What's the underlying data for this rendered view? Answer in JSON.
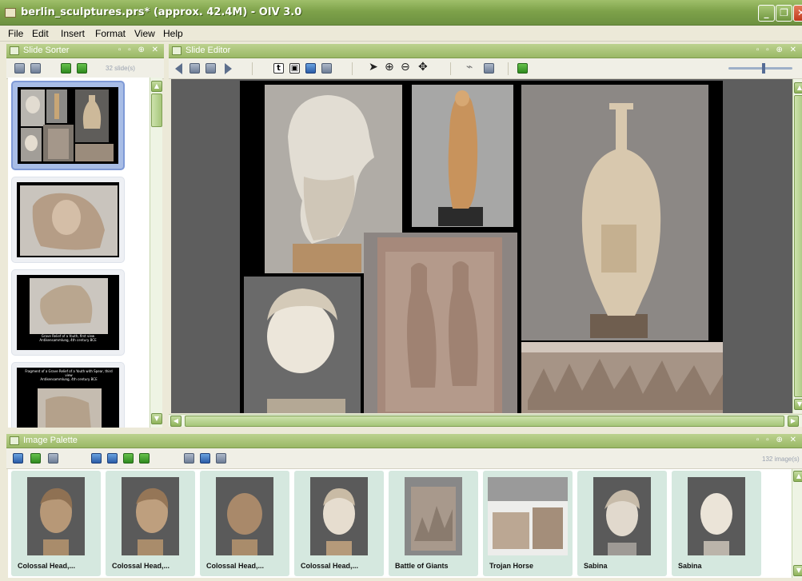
{
  "window": {
    "title": "berlin_sculptures.prs* (approx. 42.4M) - OIV 3.0"
  },
  "menu": [
    "File",
    "Edit",
    "Insert",
    "Format",
    "View",
    "Help"
  ],
  "slide_sorter": {
    "title": "Slide Sorter",
    "count": "32 slide(s)"
  },
  "slide_editor": {
    "title": "Slide Editor"
  },
  "slide_captions": {
    "slide3": "Grave Relief of a Youth, first view\nAntikensammlung, 4th century BCE",
    "slide4": "Fragment of a Grave Relief of a Youth with Spear, third view\nAntikensammlung, 4th century BCE"
  },
  "image_palette": {
    "title": "Image Palette",
    "count": "132 image(s)",
    "items": [
      "Colossal Head,...",
      "Colossal Head,...",
      "Colossal Head,...",
      "Colossal Head,...",
      "Battle of Giants",
      "Trojan Horse",
      "Sabina",
      "Sabina"
    ]
  },
  "colors": {
    "accent": "#9ab866",
    "selection": "#a8bde6",
    "canvas": "#5e5e5e"
  },
  "icons": [
    "app-icon",
    "minimize-icon",
    "maximize-icon",
    "close-icon",
    "prev-slide-icon",
    "next-slide-icon",
    "text-tool-icon",
    "select-arrow-icon",
    "zoom-in-icon",
    "zoom-out-icon",
    "pan-icon",
    "flag-icon"
  ]
}
